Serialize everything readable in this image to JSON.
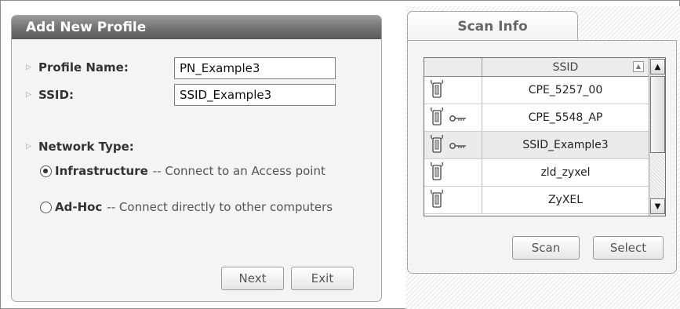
{
  "add_profile": {
    "title": "Add New Profile",
    "profile_name_label": "Profile Name:",
    "profile_name_value": "PN_Example3",
    "ssid_label": "SSID:",
    "ssid_value": "SSID_Example3",
    "network_type_label": "Network Type:",
    "network_type_selected": "Infrastructure",
    "infrastructure_title": "Infrastructure",
    "infrastructure_desc": "-- Connect to an Access point",
    "adhoc_title": "Ad-Hoc",
    "adhoc_desc": "-- Connect directly to other computers",
    "next_label": "Next",
    "exit_label": "Exit"
  },
  "scan_info": {
    "tab_label": "Scan Info",
    "column_header": "SSID",
    "rows": [
      {
        "ssid": "CPE_5257_00",
        "secured": false
      },
      {
        "ssid": "CPE_5548_AP",
        "secured": true
      },
      {
        "ssid": "SSID_Example3",
        "secured": true,
        "selected": true
      },
      {
        "ssid": "zld_zyxel",
        "secured": false
      },
      {
        "ssid": "ZyXEL",
        "secured": false
      }
    ],
    "scan_label": "Scan",
    "select_label": "Select"
  },
  "icons": {
    "ap": "access-point-icon",
    "key": "key-icon",
    "bullet": "bullet-arrow-icon",
    "sort": "sort-arrow-icon",
    "scroll_up": "scroll-up-arrow-icon",
    "scroll_down": "scroll-down-arrow-icon"
  }
}
